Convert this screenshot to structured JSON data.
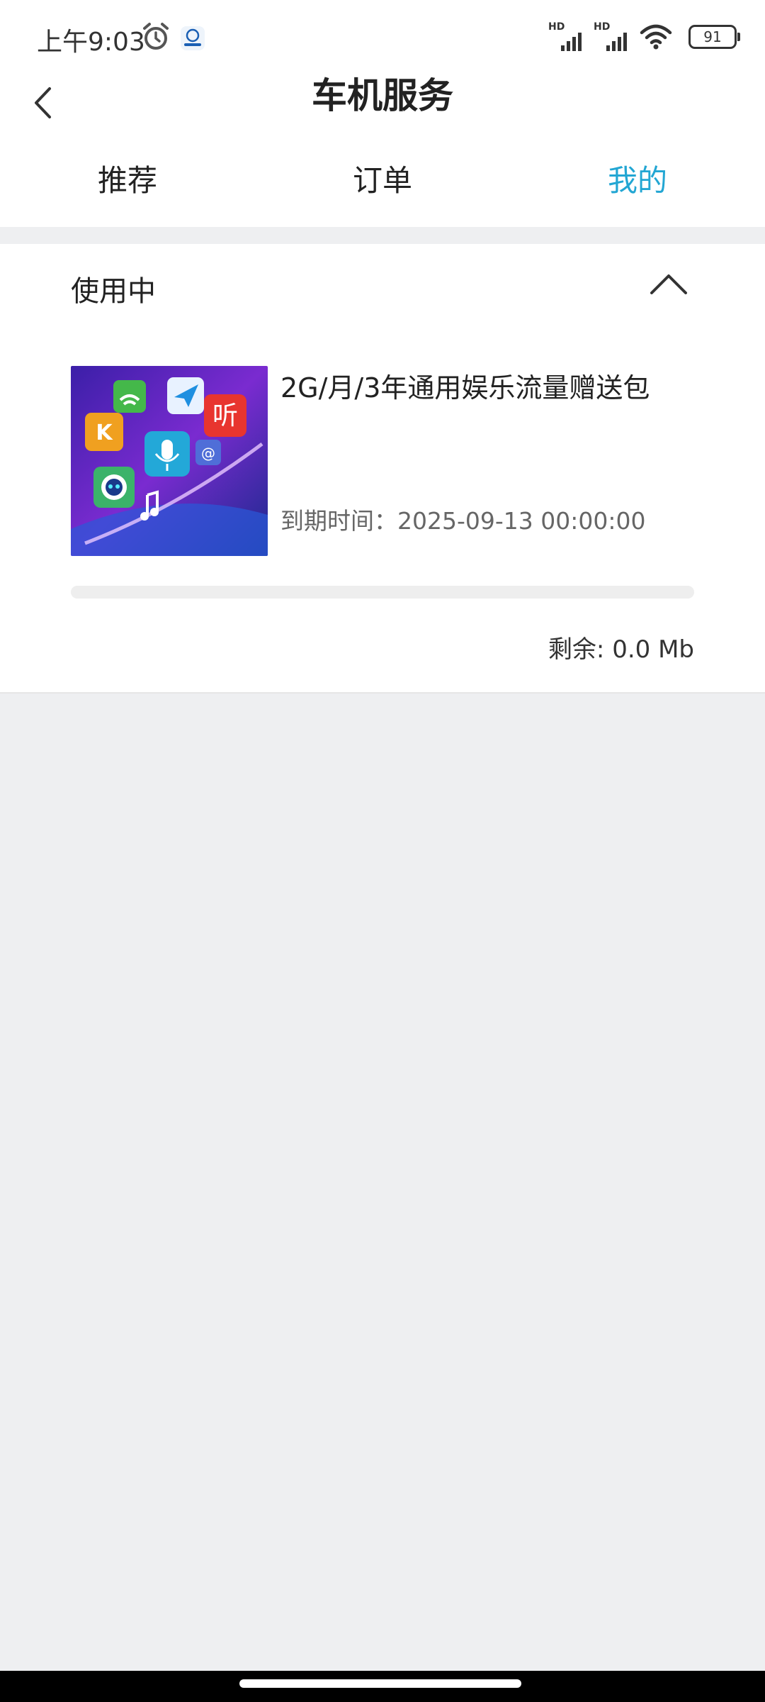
{
  "status": {
    "time": "上午9:03",
    "battery": "91",
    "hd1": "HD",
    "hd2": "HD"
  },
  "header": {
    "title": "车机服务",
    "tabs": [
      {
        "label": "推荐"
      },
      {
        "label": "订单"
      },
      {
        "label": "我的",
        "active": true
      }
    ],
    "active_color": "#22a6d3"
  },
  "section": {
    "title": "使用中",
    "item": {
      "name": "2G/月/3年通用娱乐流量赠送包",
      "expire_label": "到期时间：2025-09-13 00:00:00",
      "usage_fraction": 0,
      "remaining": "剩余: 0.0 Mb",
      "thumb_text": "听"
    }
  }
}
